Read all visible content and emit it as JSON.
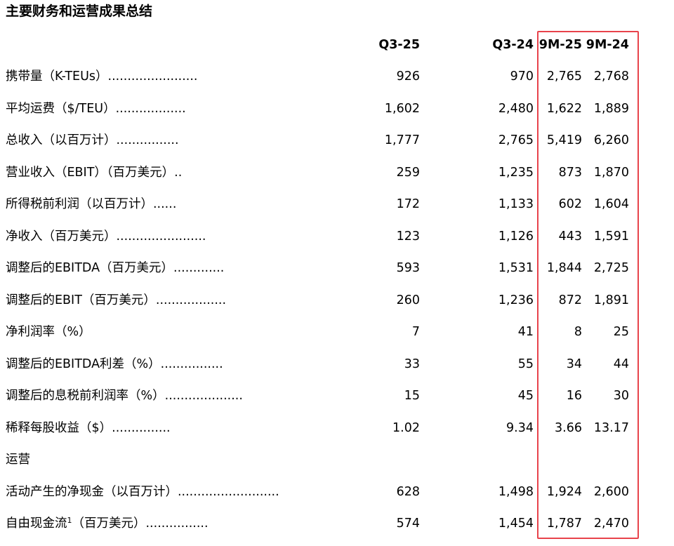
{
  "title": "主要财务和运营成果总结",
  "columns": [
    "Q3-25",
    "Q3-24",
    "9M-25",
    "9M-24"
  ],
  "rows": [
    {
      "label": "携带量（K-TEUs）.......................",
      "values": [
        "926",
        "970",
        "2,765",
        "2,768"
      ]
    },
    {
      "label": "平均运费（$/TEU）..................",
      "values": [
        "1,602",
        "2,480",
        "1,622",
        "1,889"
      ]
    },
    {
      "label": "总收入（以百万计）................",
      "values": [
        "1,777",
        "2,765",
        "5,419",
        "6,260"
      ]
    },
    {
      "label": "营业收入（EBIT）（百万美元）..",
      "values": [
        "259",
        "1,235",
        "873",
        "1,870"
      ]
    },
    {
      "label": "所得税前利润（以百万计）......",
      "values": [
        "172",
        "1,133",
        "602",
        "1,604"
      ]
    },
    {
      "label": "净收入（百万美元）.......................",
      "values": [
        "123",
        "1,126",
        "443",
        "1,591"
      ]
    },
    {
      "label": "调整后的EBITDA（百万美元）.............",
      "values": [
        "593",
        "1,531",
        "1,844",
        "2,725"
      ]
    },
    {
      "label": "调整后的EBIT（百万美元）..................",
      "values": [
        "260",
        "1,236",
        "872",
        "1,891"
      ]
    },
    {
      "label": "净利润率（%）",
      "values": [
        "7",
        "41",
        "8",
        "25"
      ]
    },
    {
      "label": "调整后的EBITDA利差（%）................",
      "values": [
        "33",
        "55",
        "34",
        "44"
      ]
    },
    {
      "label": "调整后的息税前利润率（%）....................",
      "values": [
        "15",
        "45",
        "16",
        "30"
      ]
    },
    {
      "label": "稀释每股收益（$）...............",
      "values": [
        "1.02",
        "9.34",
        "3.66",
        "13.17"
      ]
    },
    {
      "label": "运营",
      "values": [
        "",
        "",
        "",
        ""
      ]
    },
    {
      "label": "活动产生的净现金（以百万计）..........................",
      "values": [
        "628",
        "1,498",
        "1,924",
        "2,600"
      ]
    },
    {
      "label_pre": "自由现金流",
      "label_sup": "1",
      "label_post": "（百万美元）................",
      "values": [
        "574",
        "1,454",
        "1,787",
        "2,470"
      ]
    }
  ],
  "highlight_color": "#e8434b"
}
